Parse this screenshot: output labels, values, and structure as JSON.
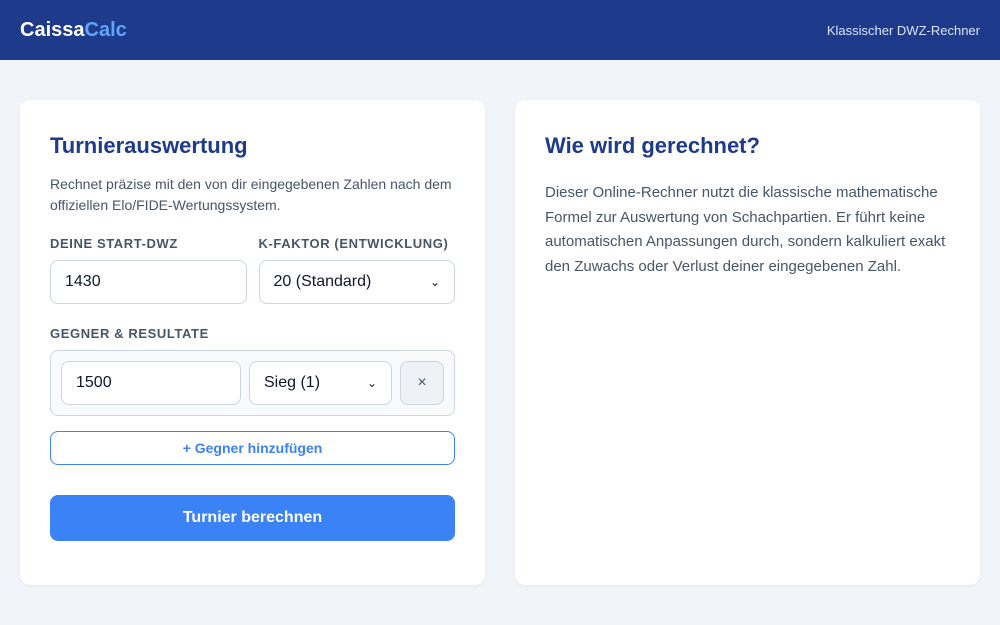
{
  "header": {
    "brand_main": "Caissa",
    "brand_accent": "Calc",
    "tagline": "Klassischer DWZ-Rechner"
  },
  "form": {
    "title": "Turnierauswertung",
    "intro": "Rechnet präzise mit den von dir eingegebenen Zahlen nach dem offiziellen Elo/FIDE-Wertungssystem.",
    "start_label": "Deine Start-DWZ",
    "start_value": "1430",
    "k_label": "K-Faktor (Entwicklung)",
    "k_value": "20 (Standard)",
    "opponents_label": "Gegner & Resultate",
    "opponents": [
      {
        "rating": "1500",
        "result": "Sieg (1)",
        "remove": "×"
      }
    ],
    "add_label": "+ Gegner hinzufügen",
    "calc_label": "Turnier berechnen"
  },
  "info": {
    "title": "Wie wird gerechnet?",
    "text": "Dieser Online-Rechner nutzt die klassische mathematische Formel zur Auswertung von Schachpartien. Er führt keine automatischen Anpassungen durch, sondern kalkuliert exakt den Zuwachs oder Verlust deiner eingegebenen Zahl."
  },
  "icons": {
    "remove": "close-icon",
    "dropdown": "chevron-down-icon"
  },
  "colors": {
    "header_bg": "#1e3a8a",
    "accent": "#3b82f6",
    "brand_accent": "#60a5fa",
    "page_bg": "#f1f5f9"
  }
}
